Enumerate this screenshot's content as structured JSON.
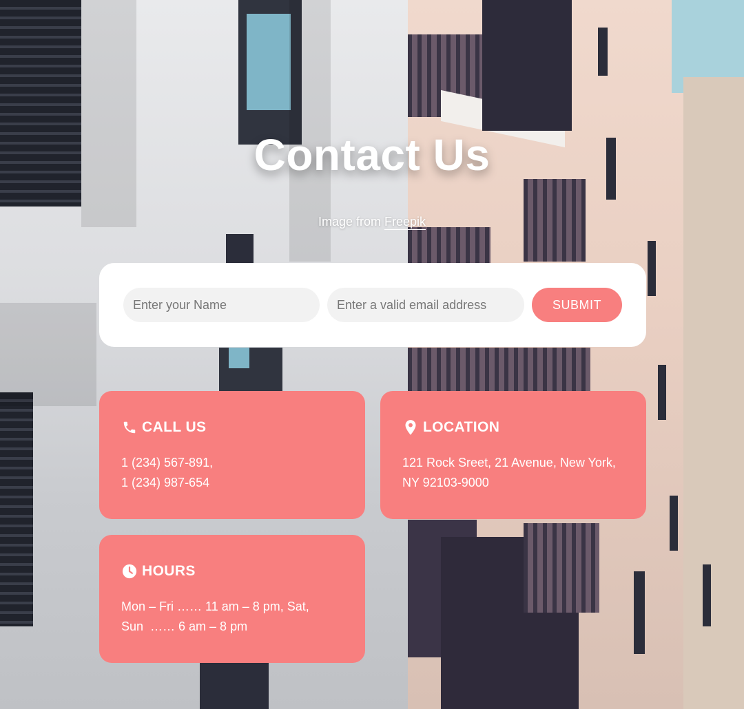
{
  "hero": {
    "title": "Contact Us",
    "credit_prefix": "Image from ",
    "credit_link": "Freepik"
  },
  "form": {
    "name_placeholder": "Enter your Name",
    "email_placeholder": "Enter a valid email address",
    "submit_label": "SUBMIT"
  },
  "cards": {
    "call": {
      "icon": "phone-icon",
      "heading": "CALL US",
      "lines": [
        "1 (234) 567-891,",
        "1 (234) 987-654"
      ]
    },
    "location": {
      "icon": "map-pin-icon",
      "heading": "LOCATION",
      "lines": [
        "121 Rock Sreet, 21 Avenue, New York,",
        "NY 92103-9000"
      ]
    },
    "hours": {
      "icon": "clock-icon",
      "heading": "HOURS",
      "lines": [
        "Mon – Fri …… 11 am – 8 pm, Sat,",
        "Sun  …… 6 am – 8 pm"
      ]
    }
  },
  "colors": {
    "accent": "#f87f7f",
    "card_text": "#ffffff",
    "form_bg": "#ffffff",
    "input_bg": "#f2f2f2"
  }
}
